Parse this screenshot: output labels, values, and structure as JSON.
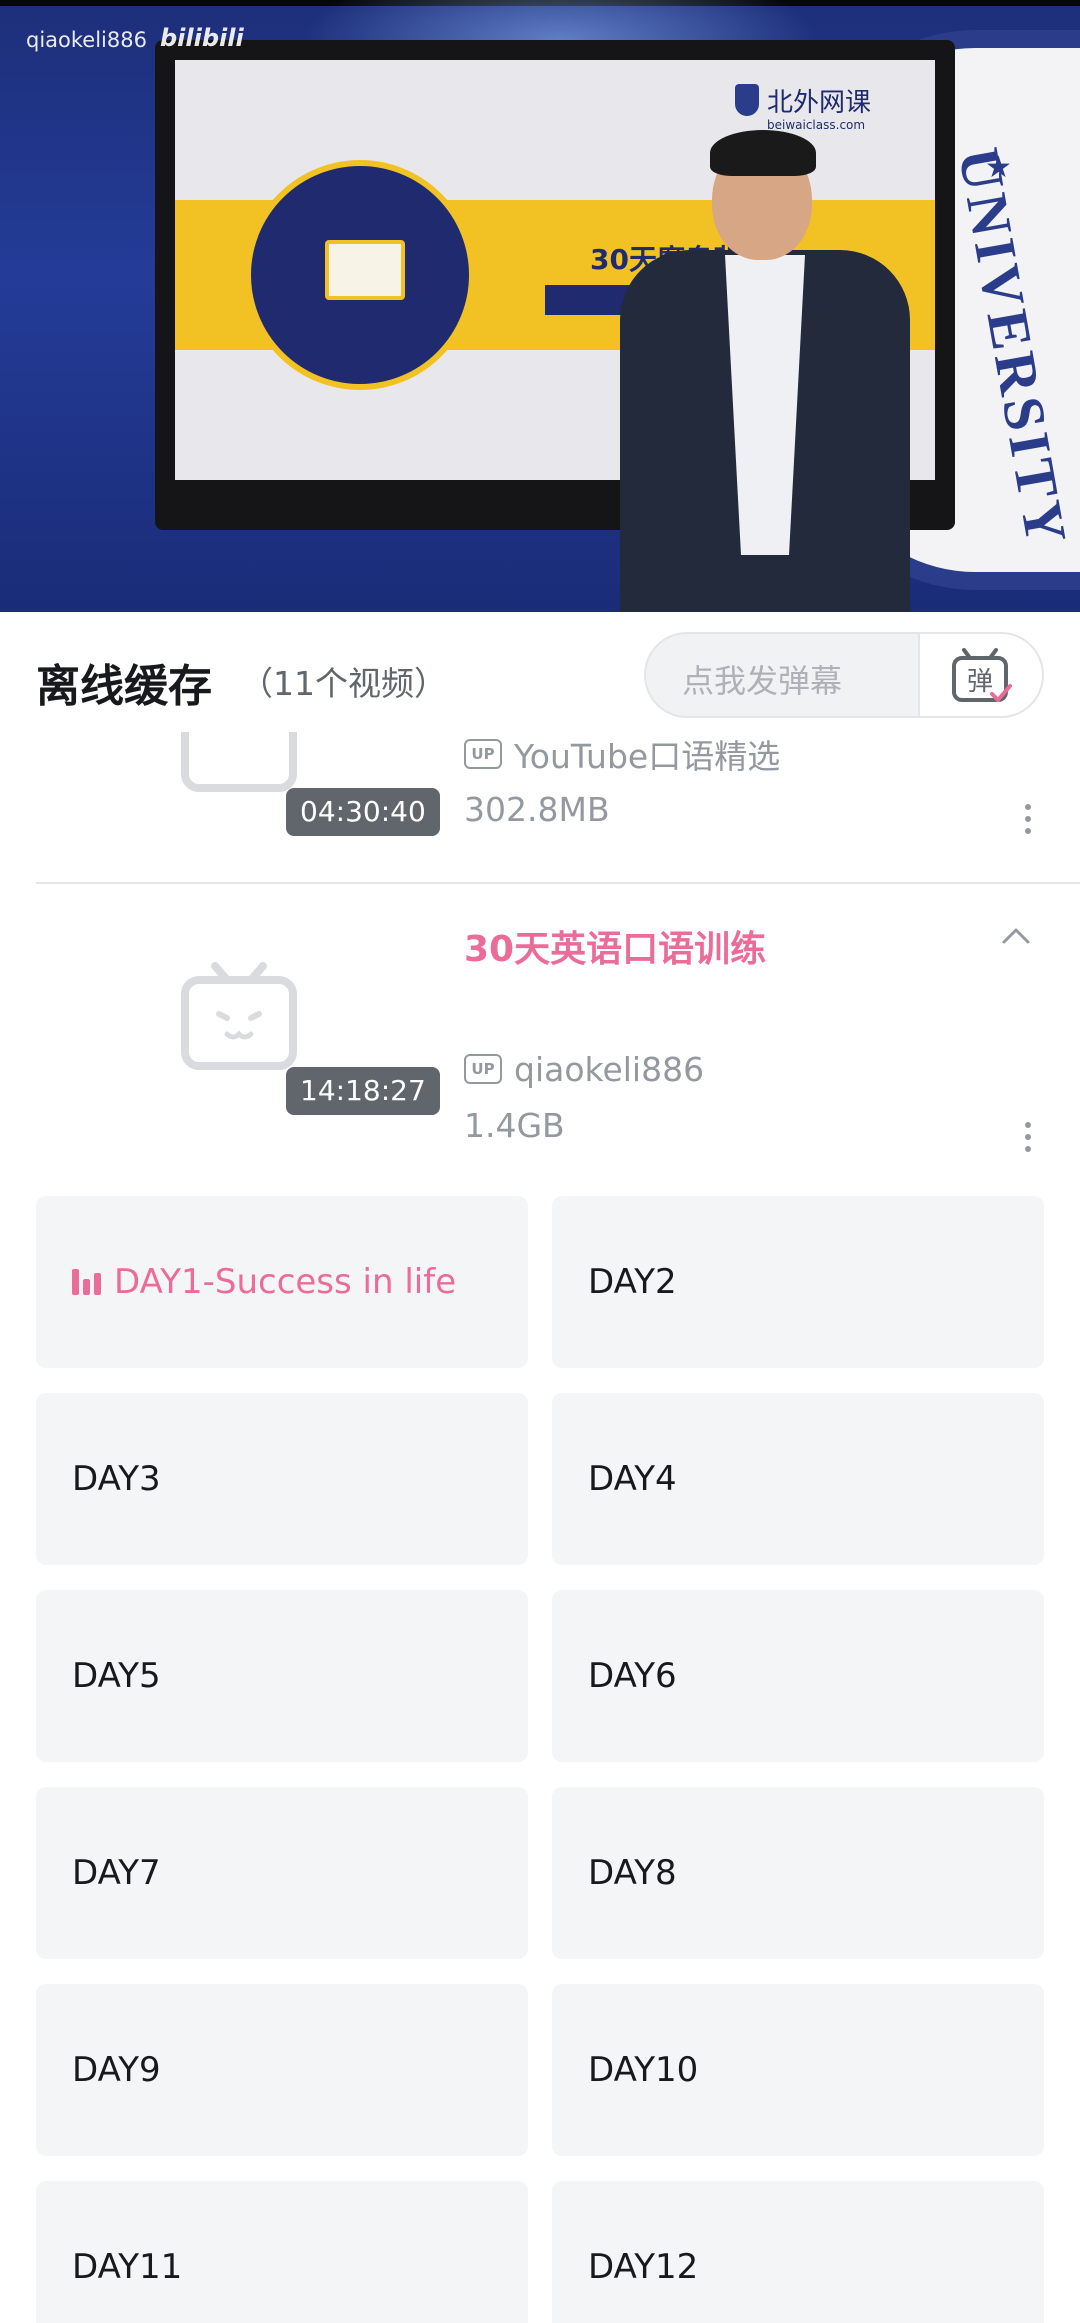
{
  "video": {
    "watermark_user": "qiaokeli886",
    "watermark_logo": "bilibili",
    "screen_brand": "北外网课",
    "screen_brand_sub": "beiwaiclass.com",
    "screen_title": "30天魔鬼背",
    "emblem_text": "UNIVERSITY"
  },
  "header": {
    "title": "离线缓存",
    "subtitle": "（11个视频）",
    "danmaku_placeholder": "点我发弹幕",
    "danmaku_icon": "danmaku-toggle-icon",
    "danmaku_icon_text": "弹"
  },
  "items": [
    {
      "duration": "04:30:40",
      "uploader": "YouTube口语精选",
      "size": "302.8MB",
      "up_badge": "UP"
    },
    {
      "title": "30天英语口语训练",
      "duration": "14:18:27",
      "uploader": "qiaokeli886",
      "size": "1.4GB",
      "up_badge": "UP"
    }
  ],
  "episodes": [
    {
      "label": "DAY1-Success in life",
      "active": true
    },
    {
      "label": "DAY2",
      "active": false
    },
    {
      "label": "DAY3",
      "active": false
    },
    {
      "label": "DAY4",
      "active": false
    },
    {
      "label": "DAY5",
      "active": false
    },
    {
      "label": "DAY6",
      "active": false
    },
    {
      "label": "DAY7",
      "active": false
    },
    {
      "label": "DAY8",
      "active": false
    },
    {
      "label": "DAY9",
      "active": false
    },
    {
      "label": "DAY10",
      "active": false
    },
    {
      "label": "DAY11",
      "active": false
    },
    {
      "label": "DAY12",
      "active": false
    }
  ],
  "colors": {
    "accent_pink": "#eb6d97",
    "muted_gray": "#9499a0",
    "tile_bg": "#f4f5f7"
  }
}
